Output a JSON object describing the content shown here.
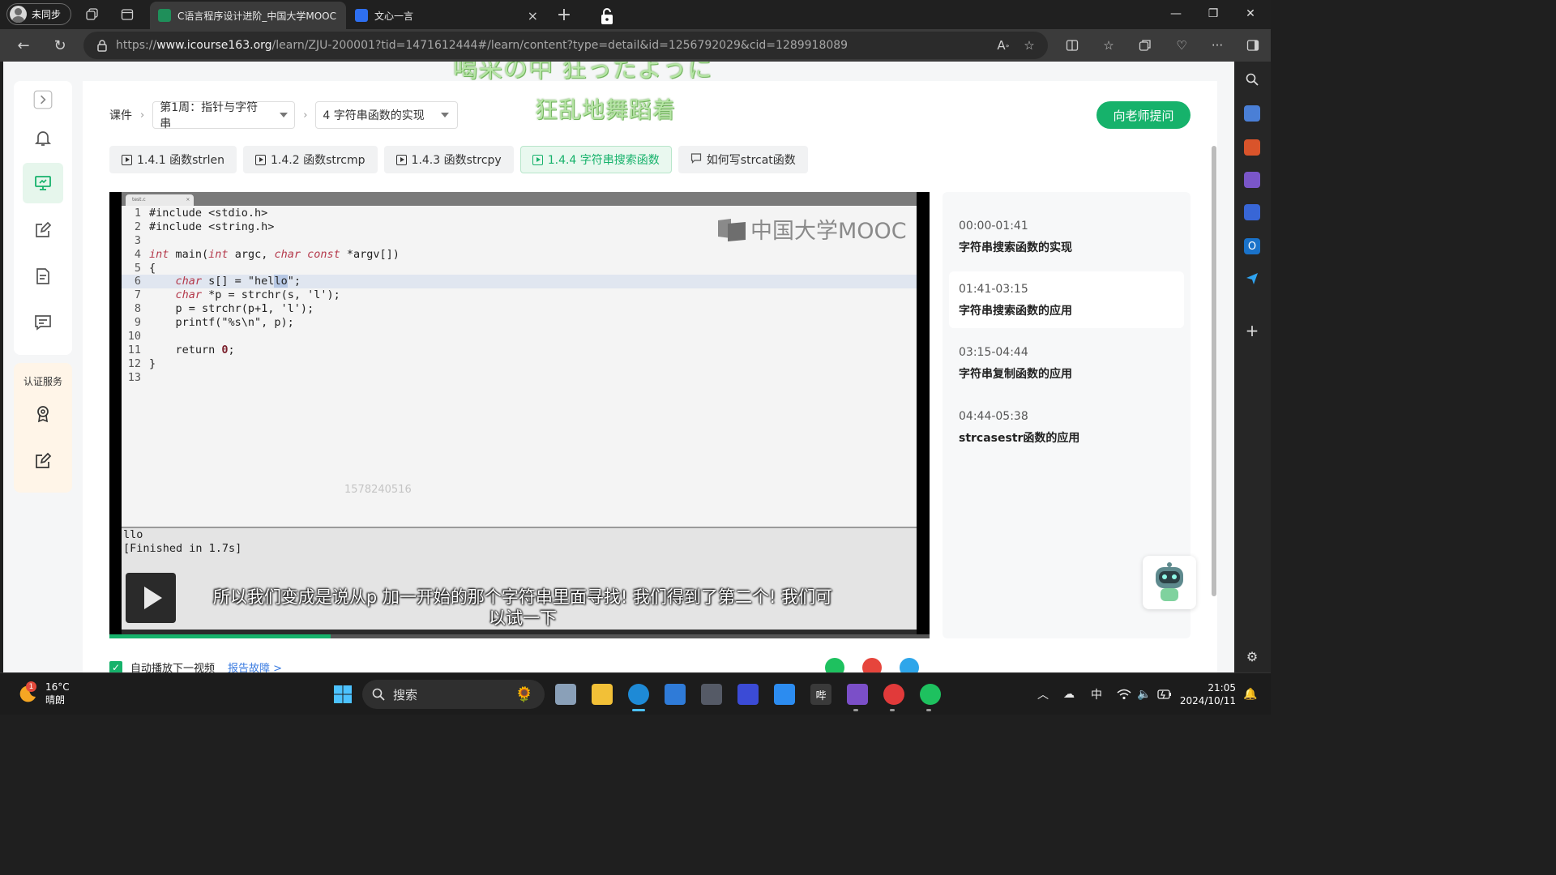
{
  "browser": {
    "profile_label": "未同步",
    "tabs": [
      {
        "title": "C语言程序设计进阶_中国大学MOOC",
        "active": true
      },
      {
        "title": "文心一言",
        "active": false
      }
    ],
    "url_prefix": "https://",
    "url_domain": "www.icourse163.org",
    "url_path": "/learn/ZJU-200001?tid=1471612444#/learn/content?type=detail&id=1256792029&cid=1289918089"
  },
  "lyrics": {
    "line1": "喝采の中 狂ったように",
    "line2": "狂乱地舞蹈着"
  },
  "sidebar": {
    "cert_title": "认证服务"
  },
  "breadcrumb": {
    "root": "课件",
    "week": "第1周：指针与字符串",
    "unit": "4 字符串函数的实现"
  },
  "ask_teacher_label": "向老师提问",
  "lesson_tabs": [
    {
      "label": "1.4.1 函数strlen",
      "active": false
    },
    {
      "label": "1.4.2 函数strcmp",
      "active": false
    },
    {
      "label": "1.4.3 函数strcpy",
      "active": false
    },
    {
      "label": "1.4.4 字符串搜索函数",
      "active": true
    },
    {
      "label": "如何写strcat函数",
      "active": false
    }
  ],
  "video": {
    "logo_text": "中国大学MOOC",
    "watermark_id": "1578240516",
    "console_lines": [
      "llo",
      "[Finished in 1.7s]"
    ],
    "subtitle_line1": "所以我们变成是说从p 加一开始的那个字符串里面寻找! 我们得到了第二个! 我们可",
    "subtitle_line2": "以试一下",
    "progress": 0.27
  },
  "code_lines": [
    {
      "n": "1",
      "text": "#include <stdio.h>"
    },
    {
      "n": "2",
      "text": "#include <string.h>"
    },
    {
      "n": "3",
      "text": ""
    },
    {
      "n": "4",
      "text": "int main(int argc, char const *argv[])"
    },
    {
      "n": "5",
      "text": "{"
    },
    {
      "n": "6",
      "text": "    char s[] = \"hello\";"
    },
    {
      "n": "7",
      "text": "    char *p = strchr(s, 'l');"
    },
    {
      "n": "8",
      "text": "    p = strchr(p+1, 'l');"
    },
    {
      "n": "9",
      "text": "    printf(\"%s\\n\", p);"
    },
    {
      "n": "10",
      "text": ""
    },
    {
      "n": "11",
      "text": "    return 0;"
    },
    {
      "n": "12",
      "text": "}"
    },
    {
      "n": "13",
      "text": ""
    }
  ],
  "chapters": [
    {
      "time": "00:00-01:41",
      "title": "字符串搜索函数的实现",
      "active": false
    },
    {
      "time": "01:41-03:15",
      "title": "字符串搜索函数的应用",
      "active": true
    },
    {
      "time": "03:15-04:44",
      "title": "字符串复制函数的应用",
      "active": false
    },
    {
      "time": "04:44-05:38",
      "title": "strcasestr函数的应用",
      "active": false
    }
  ],
  "footer": {
    "autoplay_label": "自动播放下一视频",
    "autoplay_checked": true,
    "report_label": "报告故障 >"
  },
  "taskbar": {
    "weather_temp": "16°C",
    "weather_desc": "晴朗",
    "weather_badge": "1",
    "search_placeholder": "搜索",
    "ime_label": "中",
    "time": "21:05",
    "date": "2024/10/11"
  },
  "colors": {
    "accent": "#16b26b",
    "lyric": "#b6e6a5"
  }
}
